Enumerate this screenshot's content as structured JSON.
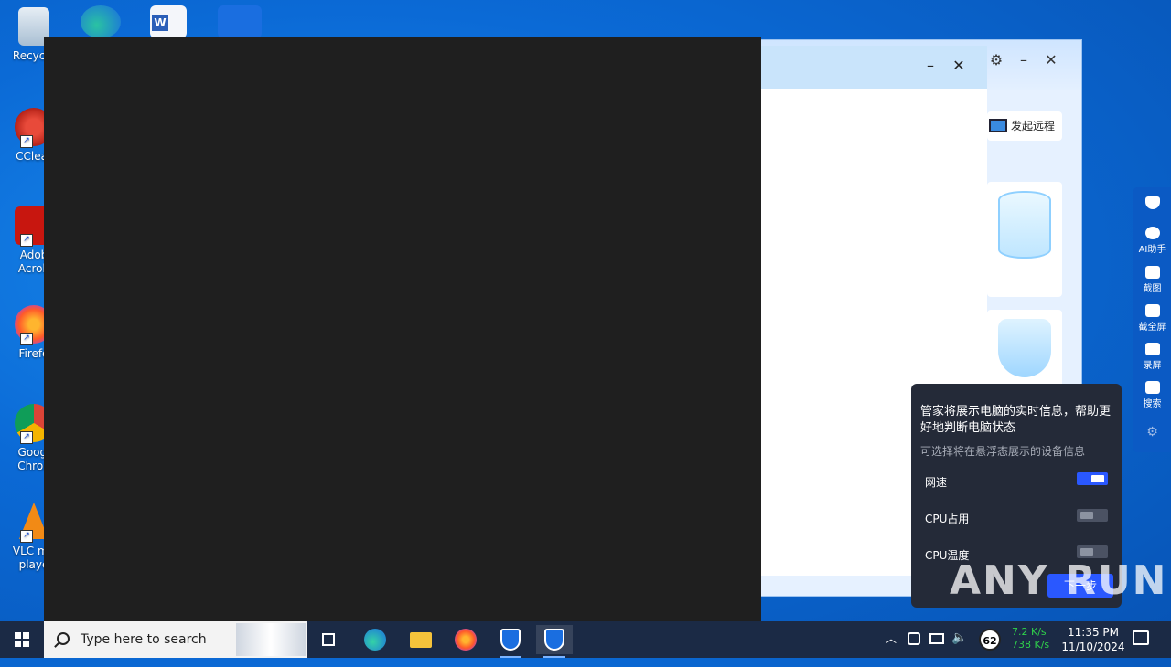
{
  "desktop": {
    "icons": [
      {
        "label": "Recycle"
      },
      {
        "label": "CClear"
      },
      {
        "label": "Adob Acrob"
      },
      {
        "label": "Firefo"
      },
      {
        "label": "Googl Chron"
      },
      {
        "label": "VLC me playe"
      }
    ]
  },
  "app": {
    "remote_button": "发起远程"
  },
  "sidebar": {
    "items": [
      {
        "label": ""
      },
      {
        "label": "AI助手"
      },
      {
        "label": "截图"
      },
      {
        "label": "截全屏"
      },
      {
        "label": "录屏"
      },
      {
        "label": "搜索"
      }
    ]
  },
  "popup": {
    "title": "管家将展示电脑的实时信息，帮助更好地判断电脑状态",
    "subtitle": "可选择将在悬浮态展示的设备信息",
    "options": [
      {
        "label": "网速",
        "enabled": true
      },
      {
        "label": "CPU占用",
        "enabled": false
      },
      {
        "label": "CPU温度",
        "enabled": false
      }
    ],
    "next_button": "下一步"
  },
  "watermark": "ANY RUN",
  "taskbar": {
    "search_placeholder": "Type here to search",
    "badge_value": "62",
    "net_up": "7.2 K/s",
    "net_down": "738 K/s",
    "time": "11:35 PM",
    "date": "11/10/2024"
  },
  "colors": {
    "desktop_blue": "#0b6ad6",
    "taskbar": "#1b2a45",
    "popup_bg": "#242a38",
    "toggle_on": "#2a58ff",
    "sidebar": "#0b5ac4"
  }
}
